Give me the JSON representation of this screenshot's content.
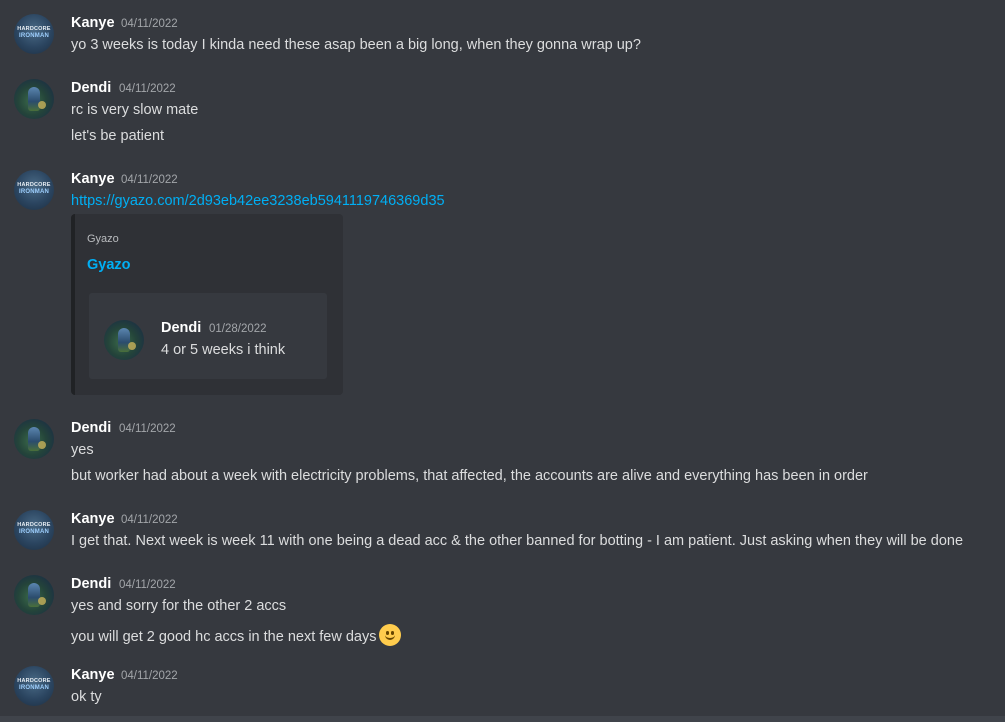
{
  "messages": [
    {
      "author": "Kanye",
      "timestamp": "04/11/2022",
      "avatar_text": [
        "HARDCORE",
        "IRONMAN"
      ],
      "lines": [
        "yo 3 weeks is today I kinda need these asap been a big long, when they gonna wrap up?"
      ]
    },
    {
      "author": "Dendi",
      "timestamp": "04/11/2022",
      "lines": [
        "rc is very slow mate",
        "let's be patient"
      ]
    },
    {
      "author": "Kanye",
      "timestamp": "04/11/2022",
      "avatar_text": [
        "HARDCORE",
        "IRONMAN"
      ],
      "link": "https://gyazo.com/2d93eb42ee3238eb5941119746369d35",
      "embed": {
        "provider": "Gyazo",
        "title": "Gyazo",
        "quote": {
          "author": "Dendi",
          "timestamp": "01/28/2022",
          "text": "4 or 5 weeks i think"
        }
      }
    },
    {
      "author": "Dendi",
      "timestamp": "04/11/2022",
      "lines": [
        "yes",
        "but  worker had about a week with electricity problems, that affected, the accounts are alive and everything has been in order"
      ]
    },
    {
      "author": "Kanye",
      "timestamp": "04/11/2022",
      "avatar_text": [
        "HARDCORE",
        "IRONMAN"
      ],
      "lines": [
        "I get that. Next week is week 11 with one being a dead acc & the other banned for botting - I am patient. Just asking when they will be done"
      ]
    },
    {
      "author": "Dendi",
      "timestamp": "04/11/2022",
      "lines": [
        "yes and sorry for the other 2 accs",
        "you will get 2 good hc accs in the next few days"
      ],
      "emoji": "slightly-smiling-face"
    },
    {
      "author": "Kanye",
      "timestamp": "04/11/2022",
      "avatar_text": [
        "HARDCORE",
        "IRONMAN"
      ],
      "lines": [
        "ok ty"
      ]
    }
  ],
  "colors": {
    "background": "#36393f",
    "embed_background": "#2f3136",
    "link": "#00aff4",
    "author": "#ffffff",
    "text": "#dcddde",
    "timestamp": "#a3a6aa"
  }
}
